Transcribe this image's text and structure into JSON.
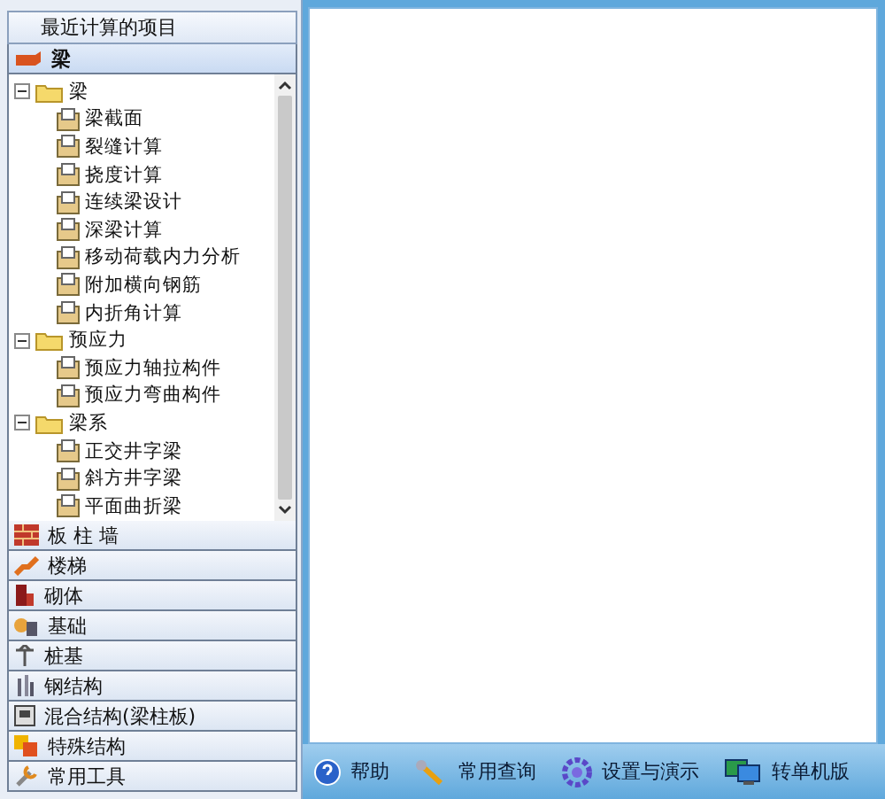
{
  "recent": {
    "label": "最近计算的项目"
  },
  "categories": [
    {
      "label": "梁",
      "selected": true,
      "tree": [
        {
          "label": "梁",
          "expanded": true,
          "children": [
            {
              "label": "梁截面"
            },
            {
              "label": "裂缝计算"
            },
            {
              "label": "挠度计算"
            },
            {
              "label": "连续梁设计"
            },
            {
              "label": "深梁计算"
            },
            {
              "label": "移动荷载内力分析"
            },
            {
              "label": "附加横向钢筋"
            },
            {
              "label": "内折角计算"
            }
          ]
        },
        {
          "label": "预应力",
          "expanded": true,
          "children": [
            {
              "label": "预应力轴拉构件"
            },
            {
              "label": "预应力弯曲构件"
            }
          ]
        },
        {
          "label": "梁系",
          "expanded": true,
          "children": [
            {
              "label": "正交井字梁"
            },
            {
              "label": "斜方井字梁"
            },
            {
              "label": "平面曲折梁"
            }
          ]
        }
      ]
    },
    {
      "label": "板 柱 墙",
      "selected": false
    },
    {
      "label": "楼梯",
      "selected": false
    },
    {
      "label": "砌体",
      "selected": false
    },
    {
      "label": "基础",
      "selected": false
    },
    {
      "label": "桩基",
      "selected": false
    },
    {
      "label": "钢结构",
      "selected": false
    },
    {
      "label": "混合结构(梁柱板)",
      "selected": false
    },
    {
      "label": "特殊结构",
      "selected": false
    },
    {
      "label": "常用工具",
      "selected": false
    }
  ],
  "bottom_bar": [
    {
      "label": "帮助"
    },
    {
      "label": "常用查询"
    },
    {
      "label": "设置与演示"
    },
    {
      "label": "转单机版"
    }
  ]
}
